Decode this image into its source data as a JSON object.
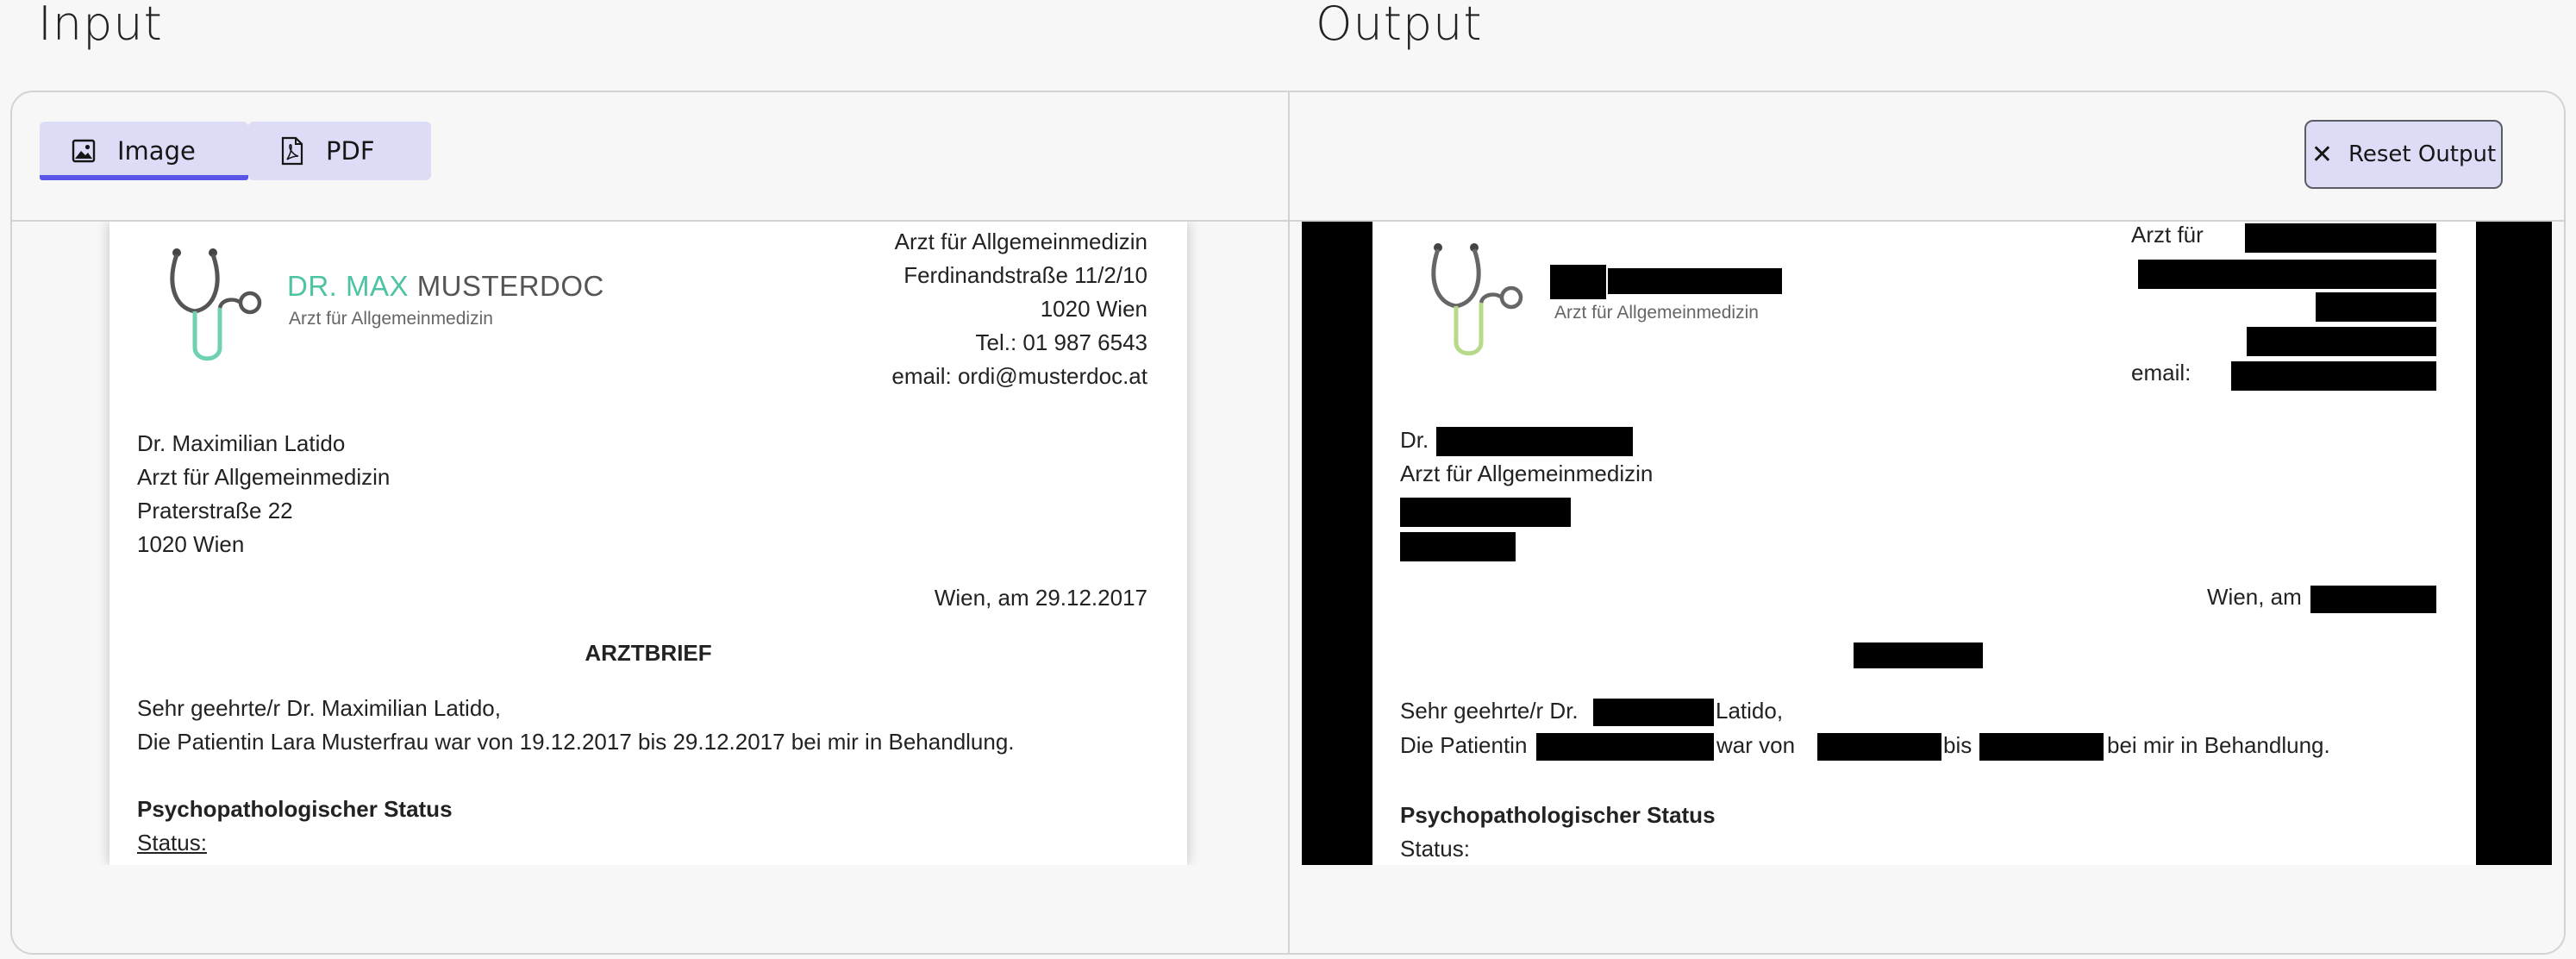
{
  "labels": {
    "input": "Input",
    "output": "Output"
  },
  "tabs": [
    {
      "label": "Image",
      "icon": "image-icon",
      "active": true
    },
    {
      "label": "PDF",
      "icon": "pdf-icon",
      "active": false
    }
  ],
  "reset": {
    "label": "Reset Output",
    "icon": "close-icon"
  },
  "colors": {
    "tab_bg": "#dcdcf7",
    "tab_active_underline": "#5b54e8",
    "logo_teal": "#4ec3a3",
    "logo_dark": "#555555",
    "redaction": "#000000"
  },
  "input_doc": {
    "logo": {
      "name_part1": "DR. MAX",
      "name_part2": "MUSTERDOC",
      "subtitle": "Arzt für Allgemeinmedizin"
    },
    "header_right": [
      "Arzt für Allgemeinmedizin",
      "Ferdinandstraße 11/2/10",
      "1020 Wien",
      "Tel.: 01 987 6543",
      "email: ordi@musterdoc.at"
    ],
    "recipient": [
      "Dr. Maximilian Latido",
      "Arzt für Allgemeinmedizin",
      "Praterstraße 22",
      "1020 Wien"
    ],
    "date": "Wien, am 29.12.2017",
    "title": "ARZTBRIEF",
    "body": [
      "Sehr geehrte/r Dr. Maximilian Latido,",
      "Die Patientin Lara Musterfrau war von 19.12.2017 bis 29.12.2017 bei mir in Behandlung."
    ],
    "section_heading": "Psychopathologischer Status",
    "status_label": "Status:"
  },
  "output_doc": {
    "logo_subtitle": "Arzt für Allgemeinmedizin",
    "header_line1_prefix": "Arzt für",
    "email_prefix": "email:",
    "recipient_prefix": "Dr.",
    "recipient_line2": "Arzt für Allgemeinmedizin",
    "date_prefix": "Wien, am",
    "greeting_prefix": "Sehr geehrte/r Dr.",
    "greeting_suffix": "Latido,",
    "patient_prefix": "Die Patientin",
    "war_von": "war von",
    "bis": "bis",
    "patient_suffix": "bei mir in Behandlung.",
    "section_heading": "Psychopathologischer Status",
    "status_label": "Status:"
  }
}
